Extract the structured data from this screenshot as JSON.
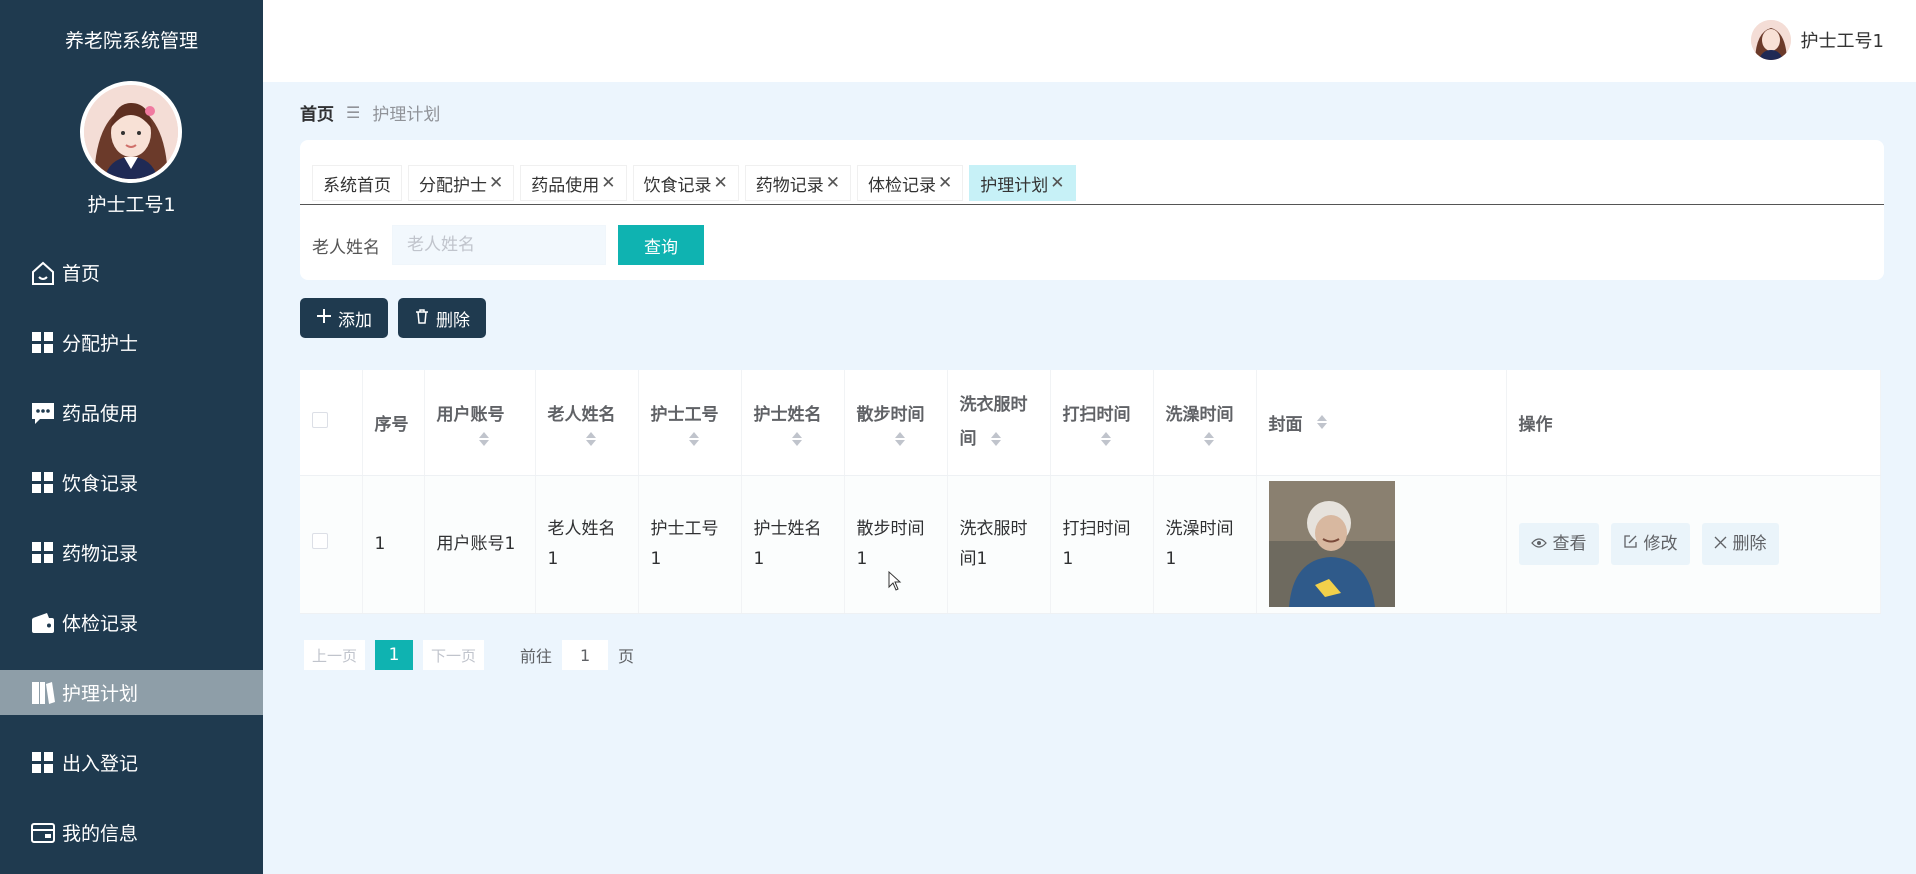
{
  "app": {
    "title": "养老院系统管理"
  },
  "sidebar": {
    "username": "护士工号1",
    "items": [
      {
        "label": "首页",
        "icon": "home-icon"
      },
      {
        "label": "分配护士",
        "icon": "grid-icon"
      },
      {
        "label": "药品使用",
        "icon": "chat-icon"
      },
      {
        "label": "饮食记录",
        "icon": "grid-icon"
      },
      {
        "label": "药物记录",
        "icon": "grid-icon"
      },
      {
        "label": "体检记录",
        "icon": "wallet-icon"
      },
      {
        "label": "护理计划",
        "icon": "book-icon",
        "active": true
      },
      {
        "label": "出入登记",
        "icon": "grid-icon"
      },
      {
        "label": "我的信息",
        "icon": "card-icon"
      }
    ]
  },
  "topbar": {
    "username": "护士工号1"
  },
  "breadcrumb": {
    "home": "首页",
    "separator": "☰",
    "current": "护理计划"
  },
  "tags": [
    {
      "label": "系统首页",
      "closable": false
    },
    {
      "label": "分配护士",
      "closable": true
    },
    {
      "label": "药品使用",
      "closable": true
    },
    {
      "label": "饮食记录",
      "closable": true
    },
    {
      "label": "药物记录",
      "closable": true
    },
    {
      "label": "体检记录",
      "closable": true
    },
    {
      "label": "护理计划",
      "closable": true,
      "active": true
    }
  ],
  "search": {
    "label": "老人姓名",
    "placeholder": "老人姓名",
    "value": "",
    "button": "查询"
  },
  "actions": {
    "add": "添加",
    "delete": "删除"
  },
  "table": {
    "headers": {
      "index": "序号",
      "account": "用户账号",
      "elder_name": "老人姓名",
      "nurse_no": "护士工号",
      "nurse_name": "护士姓名",
      "walk": "散步时间",
      "laundry_1": "洗衣服时",
      "laundry_2": "间",
      "cleaning": "打扫时间",
      "bath": "洗澡时间",
      "cover": "封面",
      "ops": "操作"
    },
    "rows": [
      {
        "index": "1",
        "account": "用户账号1",
        "elder_name_1": "老人姓名",
        "elder_name_2": "1",
        "nurse_no_1": "护士工号",
        "nurse_no_2": "1",
        "nurse_name_1": "护士姓名",
        "nurse_name_2": "1",
        "walk_1": "散步时间",
        "walk_2": "1",
        "laundry_1": "洗衣服时",
        "laundry_2": "间1",
        "cleaning_1": "打扫时间",
        "cleaning_2": "1",
        "bath_1": "洗澡时间",
        "bath_2": "1",
        "ops": {
          "view": "查看",
          "edit": "修改",
          "delete": "删除"
        }
      }
    ]
  },
  "pagination": {
    "prev": "上一页",
    "current": "1",
    "next": "下一页",
    "goto": "前往",
    "goto_value": "1",
    "page_unit": "页"
  },
  "colors": {
    "sidebar": "#1f3a4f",
    "accent": "#0fb3b1",
    "background": "#ecf5fd",
    "active_tag": "#c7f1f7"
  }
}
